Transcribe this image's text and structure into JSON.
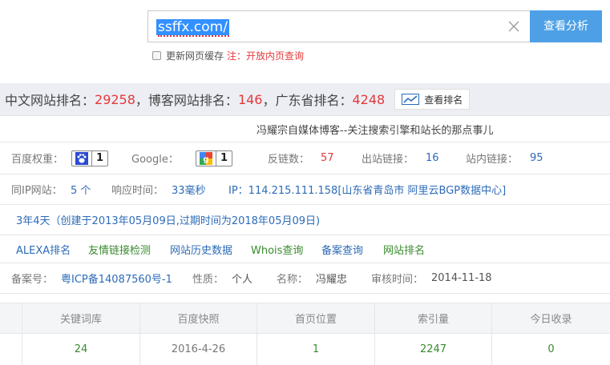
{
  "search": {
    "value": "ssffx.com/",
    "button_label": "查看分析",
    "cache_label": "更新网页缓存",
    "cache_note": "注：开放内页查询"
  },
  "ranking": {
    "cn_label": "中文网站排名：",
    "cn_value": "29258",
    "blog_label": "，博客网站排名：",
    "blog_value": "146",
    "gd_label": "，广东省排名：",
    "gd_value": "4248",
    "button_label": "查看排名"
  },
  "site": {
    "title": "冯耀宗自媒体博客--关注搜索引擎和站长的那点事儿"
  },
  "weights": {
    "baidu_label": "百度权重：",
    "baidu_value": "1",
    "google_label": "Google：",
    "google_value": "1",
    "backlinks_label": "反链数：",
    "backlinks_value": "57",
    "outlinks_label": "出站链接：",
    "outlinks_value": "16",
    "inlinks_label": "站内链接：",
    "inlinks_value": "95"
  },
  "server": {
    "sameip_label": "同IP网站：",
    "sameip_value": "5 个",
    "response_label": "响应时间：",
    "response_value": "33毫秒",
    "ip_text": "IP：114.215.111.158[山东省青岛市 阿里云BGP数据中心]"
  },
  "domain_age": "3年4天（创建于2013年05月09日,过期时间为2018年05月09日)",
  "links": [
    "ALEXA排名",
    "友情链接检测",
    "网站历史数据",
    "Whois查询",
    "备案查询",
    "网站排名"
  ],
  "icp": {
    "label": "备案号：",
    "value": "粤ICP备14087560号-1",
    "nature_label": "性质：",
    "nature_value": "个人",
    "name_label": "名称：",
    "name_value": "冯耀忠",
    "audit_label": "审核时间：",
    "audit_value": "2014-11-18"
  },
  "table": {
    "headers": [
      "关键词库",
      "百度快照",
      "首页位置",
      "索引量",
      "今日收录"
    ],
    "values": [
      "24",
      "2016-4-26",
      "1",
      "2247",
      "0"
    ]
  },
  "colors": {
    "accent": "#4ea0e6",
    "highlight": "#e4393c",
    "link": "#2d6bb8",
    "green": "#3a8a2f"
  }
}
